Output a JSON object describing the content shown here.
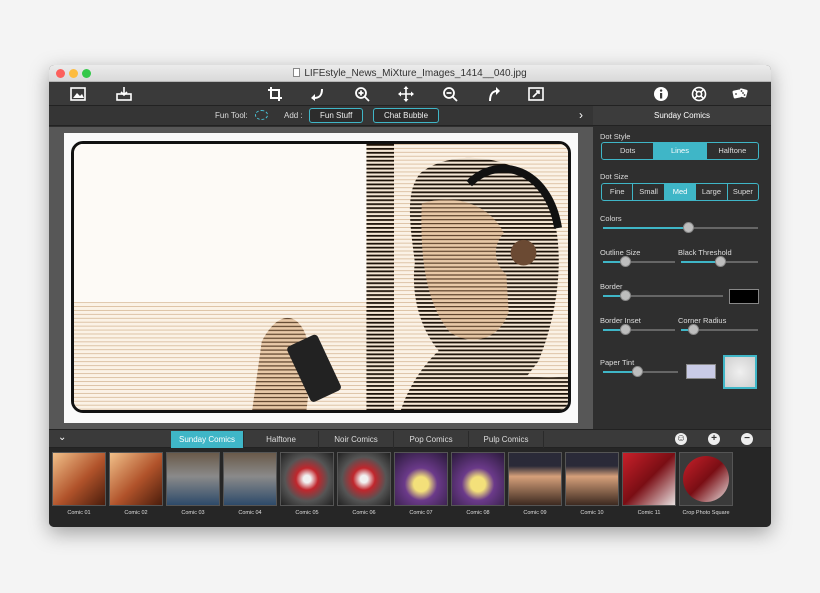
{
  "window": {
    "title": "LIFEstyle_News_MiXture_Images_1414__040.jpg"
  },
  "toolbar": {
    "icons": [
      "image-icon",
      "save-icon",
      "crop-icon",
      "rotate-left-icon",
      "zoom-in-icon",
      "move-icon",
      "zoom-out-icon",
      "rotate-right-icon",
      "resize-icon",
      "info-icon",
      "help-icon",
      "random-icon"
    ]
  },
  "optionbar": {
    "fun_tool_label": "Fun Tool:",
    "add_label": "Add :",
    "fun_stuff": "Fun Stuff",
    "chat_bubble": "Chat Bubble"
  },
  "sidebar": {
    "header": "Sunday Comics",
    "dot_style_label": "Dot Style",
    "dot_styles": [
      "Dots",
      "Lines",
      "Halftone"
    ],
    "dot_style_selected": "Lines",
    "dot_size_label": "Dot Size",
    "dot_sizes": [
      "Fine",
      "Small",
      "Med",
      "Large",
      "Super"
    ],
    "dot_size_selected": "Med",
    "colors_label": "Colors",
    "colors_level": 0.55,
    "outline_size_label": "Outline Size",
    "outline_size_level": 0.3,
    "black_threshold_label": "Black Threshold",
    "black_threshold_level": 0.5,
    "border_label": "Border",
    "border_level": 0.18,
    "border_color": "#000000",
    "border_inset_label": "Border Inset",
    "border_inset_level": 0.3,
    "corner_radius_label": "Corner Radius",
    "corner_radius_level": 0.15,
    "paper_tint_label": "Paper Tint",
    "paper_tint_level": 0.45,
    "paper_tint_color": "#c9cbe6"
  },
  "tabs": [
    "Sunday Comics",
    "Halftone",
    "Noir Comics",
    "Pop Comics",
    "Pulp Comics"
  ],
  "tab_selected": "Sunday Comics",
  "thumbnails": [
    "Comic 01",
    "Comic 02",
    "Comic 03",
    "Comic 04",
    "Comic 05",
    "Comic 06",
    "Comic 07",
    "Comic 08",
    "Comic 09",
    "Comic 10",
    "Comic 11",
    "Crop Photo Square"
  ],
  "colors": {
    "accent": "#3fb6c7"
  }
}
